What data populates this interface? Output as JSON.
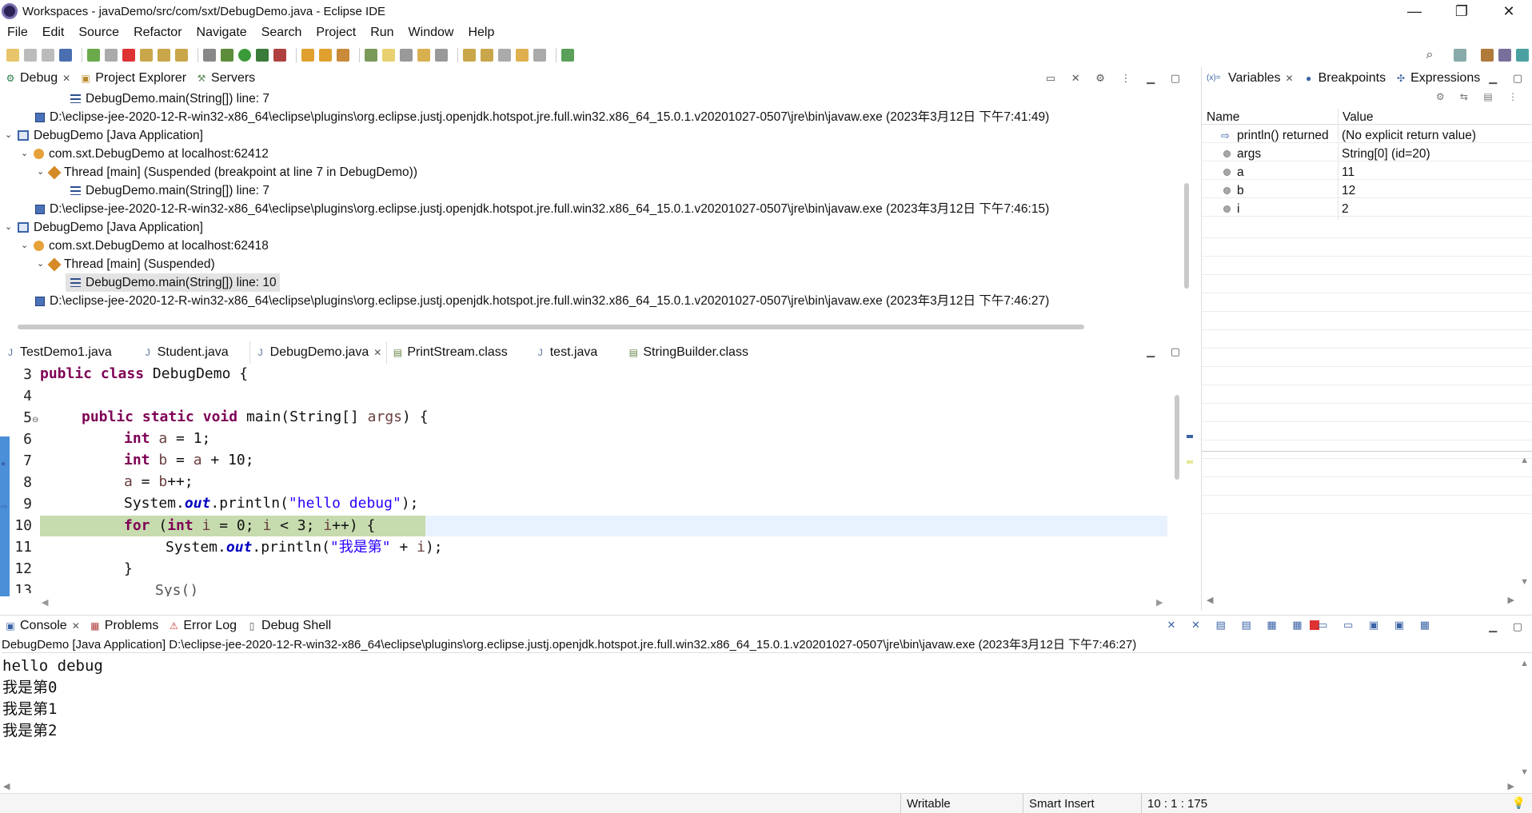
{
  "window": {
    "title": "Workspaces - javaDemo/src/com/sxt/DebugDemo.java - Eclipse IDE",
    "minimize": "—",
    "maximize": "❐",
    "close": "✕"
  },
  "menu": [
    "File",
    "Edit",
    "Source",
    "Refactor",
    "Navigate",
    "Search",
    "Project",
    "Run",
    "Window",
    "Help"
  ],
  "debug_view": {
    "tabs": [
      {
        "label": "Debug",
        "icon": "debug-icon"
      },
      {
        "label": "Project Explorer",
        "icon": "project-explorer-icon"
      },
      {
        "label": "Servers",
        "icon": "servers-icon"
      }
    ],
    "rows": [
      {
        "text": "DebugDemo.main(String[]) line: 7"
      },
      {
        "text": "D:\\eclipse-jee-2020-12-R-win32-x86_64\\eclipse\\plugins\\org.eclipse.justj.openjdk.hotspot.jre.full.win32.x86_64_15.0.1.v20201027-0507\\jre\\bin\\javaw.exe (2023年3月12日 下午7:41:49)"
      },
      {
        "text": "DebugDemo [Java Application]"
      },
      {
        "text": "com.sxt.DebugDemo at localhost:62412"
      },
      {
        "text": "Thread [main] (Suspended (breakpoint at line 7 in DebugDemo))"
      },
      {
        "text": "DebugDemo.main(String[]) line: 7"
      },
      {
        "text": "D:\\eclipse-jee-2020-12-R-win32-x86_64\\eclipse\\plugins\\org.eclipse.justj.openjdk.hotspot.jre.full.win32.x86_64_15.0.1.v20201027-0507\\jre\\bin\\javaw.exe (2023年3月12日 下午7:46:15)"
      },
      {
        "text": "DebugDemo [Java Application]"
      },
      {
        "text": "com.sxt.DebugDemo at localhost:62418"
      },
      {
        "text": "Thread [main] (Suspended)"
      },
      {
        "text": "DebugDemo.main(String[]) line: 10"
      },
      {
        "text": "D:\\eclipse-jee-2020-12-R-win32-x86_64\\eclipse\\plugins\\org.eclipse.justj.openjdk.hotspot.jre.full.win32.x86_64_15.0.1.v20201027-0507\\jre\\bin\\javaw.exe (2023年3月12日 下午7:46:27)"
      }
    ]
  },
  "variables_view": {
    "tabs": [
      {
        "label": "Variables",
        "icon": "variables-icon"
      },
      {
        "label": "Breakpoints",
        "icon": "breakpoints-icon"
      },
      {
        "label": "Expressions",
        "icon": "expressions-icon"
      }
    ],
    "columns": [
      "Name",
      "Value"
    ],
    "rows": [
      {
        "name": "println() returned",
        "value": "(No explicit return value)"
      },
      {
        "name": "args",
        "value": "String[0]  (id=20)"
      },
      {
        "name": "a",
        "value": "11"
      },
      {
        "name": "b",
        "value": "12"
      },
      {
        "name": "i",
        "value": "2"
      }
    ]
  },
  "editor": {
    "tabs": [
      "TestDemo1.java",
      "Student.java",
      "DebugDemo.java",
      "PrintStream.class",
      "test.java",
      "StringBuilder.class"
    ],
    "active_tab": "DebugDemo.java",
    "line_numbers": [
      "3",
      "4",
      "5",
      "6",
      "7",
      "8",
      "9",
      "10",
      "11",
      "12",
      "13"
    ],
    "current_line": "10",
    "lines": {
      "l3_kw1": "public",
      "l3_kw2": "class",
      "l3_rest": " DebugDemo {",
      "l5_kw1": "public",
      "l5_kw2": "static",
      "l5_kw3": "void",
      "l5_rest": " main(String[] ",
      "l5_arg": "args",
      "l5_end": ") {",
      "l6_kw": "int",
      "l6_var": "a",
      "l6_rest": " = 1;",
      "l7_kw": "int",
      "l7_var": "b",
      "l7_mid": " = ",
      "l7_var2": "a",
      "l7_rest": " + 10;",
      "l8_var": "a",
      "l8_mid": " = ",
      "l8_var2": "b",
      "l8_rest": "++;",
      "l9_a": "System.",
      "l9_fld": "out",
      "l9_b": ".println(",
      "l9_str": "\"hello debug\"",
      "l9_end": ");",
      "l10_kw": "for",
      "l10_a": " (",
      "l10_kw2": "int",
      "l10_var": "i",
      "l10_b": " = 0; ",
      "l10_var2": "i",
      "l10_c": " < 3; ",
      "l10_var3": "i",
      "l10_d": "++) {",
      "l11_a": "System.",
      "l11_fld": "out",
      "l11_b": ".println(",
      "l11_str": "\"我是第\"",
      "l11_c": " + ",
      "l11_var": "i",
      "l11_end": ");",
      "l12": "}",
      "l13": "Sys()"
    }
  },
  "console_view": {
    "tabs": [
      {
        "label": "Console",
        "icon": "console-icon"
      },
      {
        "label": "Problems",
        "icon": "problems-icon"
      },
      {
        "label": "Error Log",
        "icon": "error-log-icon"
      },
      {
        "label": "Debug Shell",
        "icon": "debug-shell-icon"
      }
    ],
    "header": "DebugDemo [Java Application] D:\\eclipse-jee-2020-12-R-win32-x86_64\\eclipse\\plugins\\org.eclipse.justj.openjdk.hotspot.jre.full.win32.x86_64_15.0.1.v20201027-0507\\jre\\bin\\javaw.exe  (2023年3月12日 下午7:46:27)",
    "output": [
      "hello debug",
      "我是第0",
      "我是第1",
      "我是第2"
    ]
  },
  "status": {
    "writable": "Writable",
    "insert_mode": "Smart Insert",
    "position": "10 : 1 : 175"
  }
}
